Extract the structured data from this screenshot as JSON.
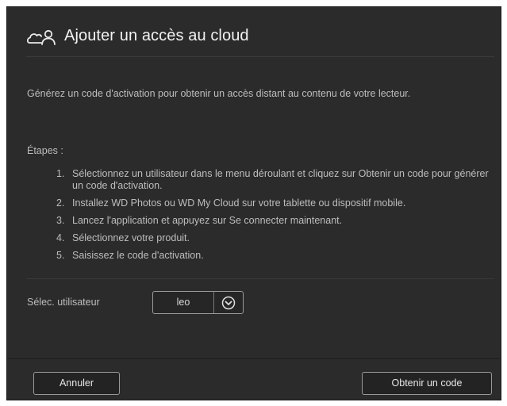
{
  "dialog": {
    "title": "Ajouter un accès au cloud",
    "title_icon": "cloud-user-icon",
    "intro": "Générez un code d'activation pour obtenir un accès distant au contenu de votre lecteur.",
    "steps_label": "Étapes :",
    "steps": [
      {
        "num": "1.",
        "text": "Sélectionnez un utilisateur dans le menu déroulant et cliquez sur Obtenir un code pour générer un code d'activation."
      },
      {
        "num": "2.",
        "text": "Installez WD Photos ou WD My Cloud sur votre tablette ou dispositif mobile."
      },
      {
        "num": "3.",
        "text": "Lancez l'application et appuyez sur Se connecter maintenant."
      },
      {
        "num": "4.",
        "text": "Sélectionnez votre produit."
      },
      {
        "num": "5.",
        "text": "Saisissez le code d'activation."
      }
    ],
    "user_select": {
      "label": "Sélec. utilisateur",
      "value": "leo",
      "icon": "chevron-down-circle-icon"
    },
    "buttons": {
      "cancel": "Annuler",
      "submit": "Obtenir un code"
    }
  },
  "colors": {
    "dialog_background": "#2b2b2b",
    "title_text": "#f2f2f2",
    "body_text": "#bdbdbd",
    "button_border": "#9a9a9a"
  }
}
